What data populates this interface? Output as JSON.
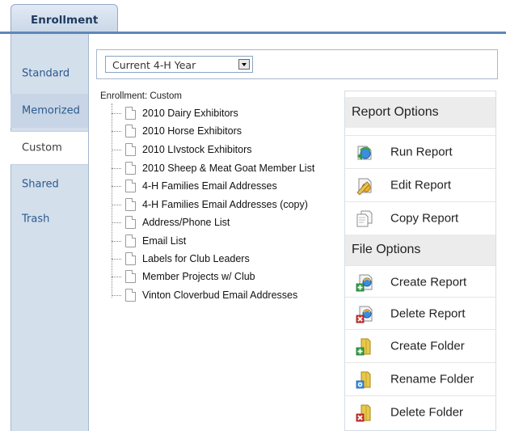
{
  "header": {
    "main_tab": "Enrollment"
  },
  "sidebar": {
    "items": [
      {
        "label": "Standard"
      },
      {
        "label": "Memorized"
      },
      {
        "label": "Custom"
      },
      {
        "label": "Shared"
      },
      {
        "label": "Trash"
      }
    ],
    "active": "Custom"
  },
  "year_select": {
    "value": "Current 4-H Year"
  },
  "tree": {
    "title": "Enrollment: Custom",
    "items": [
      "2010 Dairy Exhibitors",
      "2010 Horse Exhibitors",
      "2010 LIvstock Exhibitors",
      "2010 Sheep & Meat Goat Member List",
      "4-H Families Email Addresses",
      "4-H Families Email Addresses (copy)",
      "Address/Phone List",
      "Email List",
      "Labels for Club Leaders",
      "Member Projects w/ Club",
      "Vinton Cloverbud Email Addresses"
    ]
  },
  "report_options": {
    "title": "Report Options",
    "items": [
      {
        "label": "Run Report",
        "icon": "run-report-icon"
      },
      {
        "label": "Edit Report",
        "icon": "edit-report-icon"
      },
      {
        "label": "Copy Report",
        "icon": "copy-report-icon"
      }
    ]
  },
  "file_options": {
    "title": "File Options",
    "items": [
      {
        "label": "Create Report",
        "icon": "create-report-icon"
      },
      {
        "label": "Delete Report",
        "icon": "delete-report-icon"
      },
      {
        "label": "Create Folder",
        "icon": "create-folder-icon"
      },
      {
        "label": "Rename Folder",
        "icon": "rename-folder-icon"
      },
      {
        "label": "Delete Folder",
        "icon": "delete-folder-icon"
      }
    ]
  },
  "colors": {
    "accent": "#5f87b8",
    "sidebar_bg": "#d4dfec",
    "sidebar_text": "#2b5a8c"
  }
}
